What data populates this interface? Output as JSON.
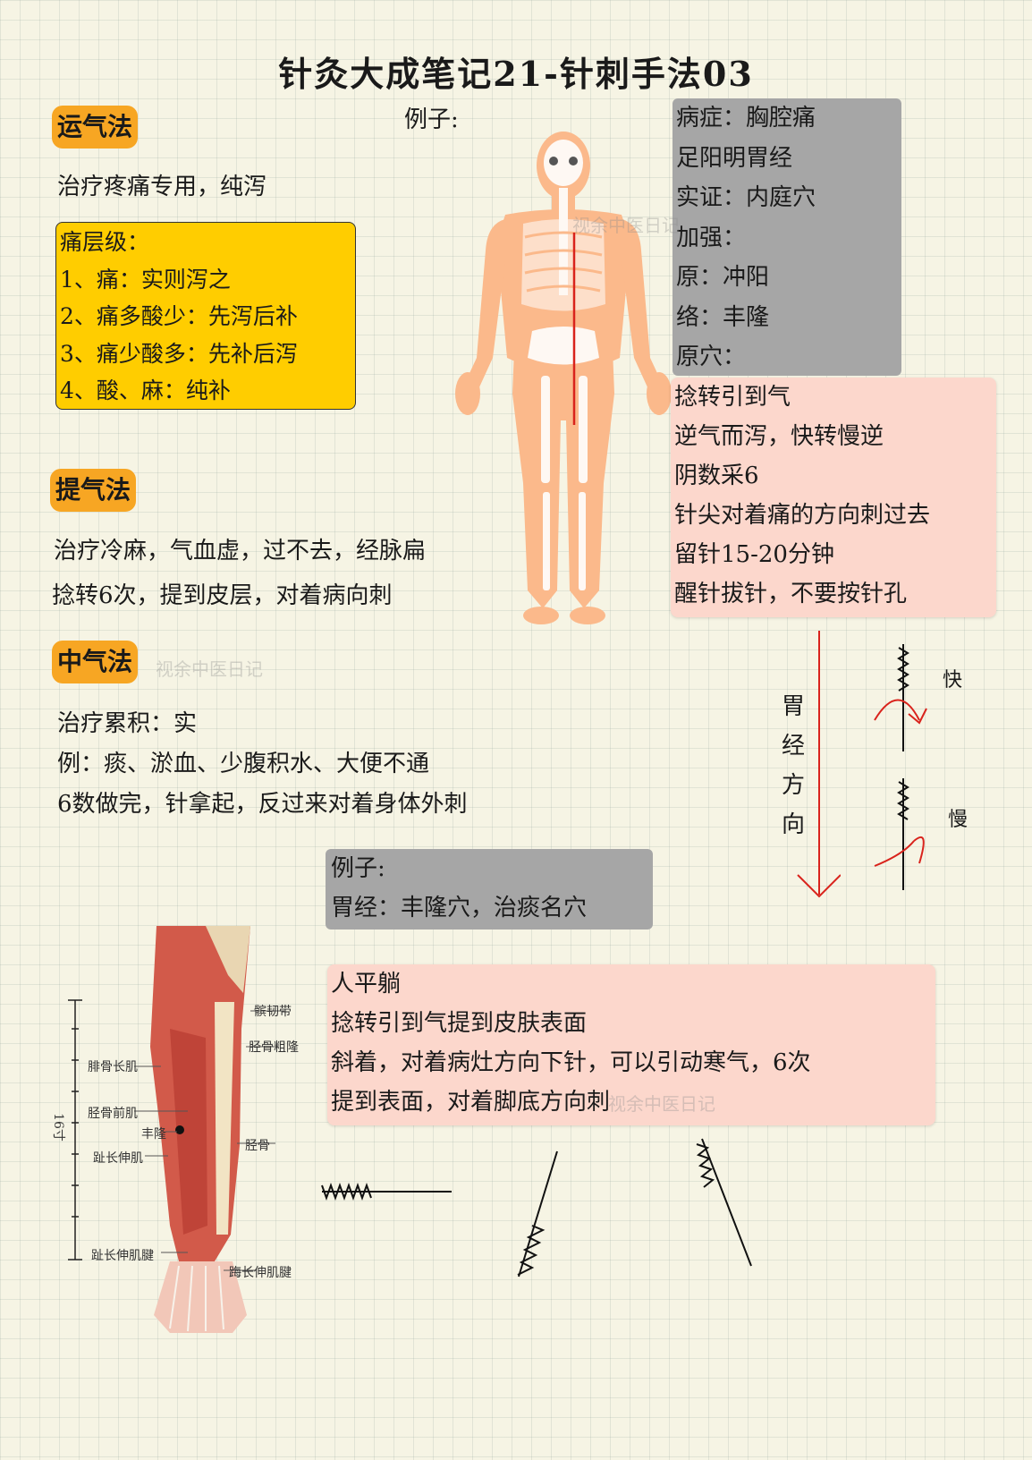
{
  "title": "针灸大成笔记21-针刺手法03",
  "section1": {
    "label": "运气法",
    "desc": "治疗疼痛专用，纯泻",
    "pain_box": [
      "痛层级：",
      "1、痛：实则泻之",
      "2、痛多酸少：先泻后补",
      "3、痛少酸多：先补后泻",
      "4、酸、麻：纯补"
    ]
  },
  "example_label": "例子:",
  "section2": {
    "label": "提气法",
    "lines": [
      "治疗冷麻，气血虚，过不去，经脉扁",
      "捻转6次，提到皮层，对着病向刺"
    ]
  },
  "section3": {
    "label": "中气法",
    "lines": [
      "治疗累积：实",
      "例：痰、淤血、少腹积水、大便不通",
      "6数做完，针拿起，反过来对着身体外刺"
    ]
  },
  "gray_box_right": [
    "病症：胸腔痛",
    "足阳明胃经",
    "实证：内庭穴",
    "加强：",
    "原：冲阳",
    "络：丰隆",
    "原穴："
  ],
  "pink_box_right": [
    "捻转引到气",
    "逆气而泻，快转慢逆",
    "阴数采6",
    "针尖对着痛的方向刺过去",
    "留针15-20分钟",
    "醒针拔针，不要按针孔"
  ],
  "direction_label": [
    "胃",
    "经",
    "方",
    "向"
  ],
  "speed_labels": {
    "fast": "快",
    "slow": "慢"
  },
  "gray_box_bottom": [
    "例子:",
    "胃经：丰隆穴，治痰名穴"
  ],
  "pink_box_bottom": [
    "人平躺",
    "捻转引到气提到皮肤表面",
    "斜着，对着病灶方向下针，可以引动寒气，6次",
    "提到表面，对着脚底方向刺"
  ],
  "leg_labels": {
    "ligament": "髌韧带",
    "tibial_tuberosity": "胫骨粗隆",
    "peroneus_longus": "腓骨长肌",
    "tibialis_anterior": "胫骨前肌",
    "fenglong": "丰隆",
    "tibia": "胫骨",
    "ext_dig_longus": "趾长伸肌",
    "ext_dig_tendon": "趾长伸肌腱",
    "ext_hal_tendon": "踇长伸肌腱",
    "ruler": "16寸"
  },
  "watermark": "视余中医日记",
  "colors": {
    "accent_orange": "#f7a623",
    "highlight_yellow": "#ffcd00",
    "gray_box": "#a6a6a6",
    "pink_box": "#fcd7cc",
    "red_line": "#d9231c"
  }
}
